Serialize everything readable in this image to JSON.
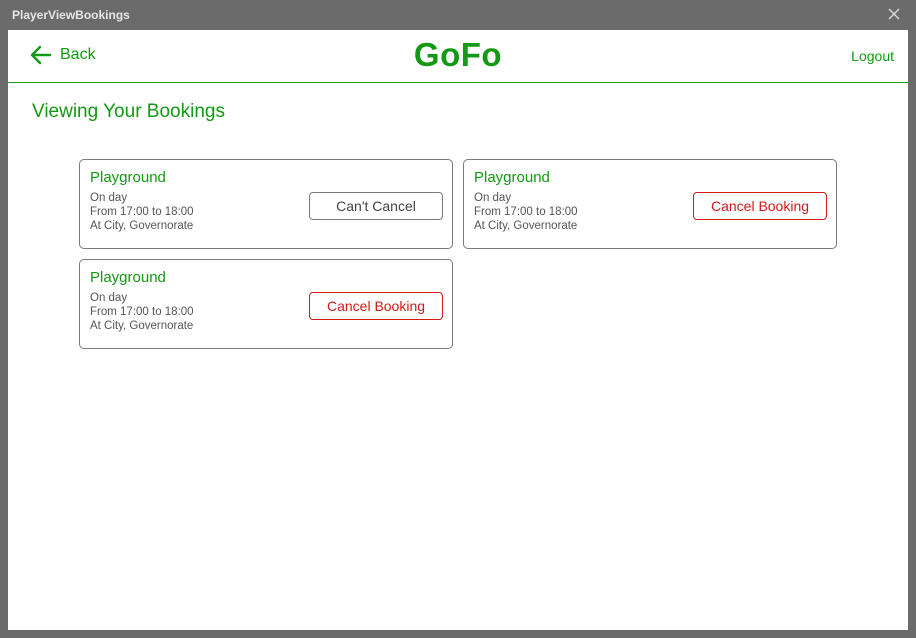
{
  "window": {
    "title": "PlayerViewBookings"
  },
  "header": {
    "back_label": "Back",
    "brand": "GoFo",
    "logout_label": "Logout"
  },
  "page": {
    "title": "Viewing Your Bookings"
  },
  "bookings": [
    {
      "place": "Playground",
      "day": "On day",
      "time": "From 17:00 to 18:00",
      "location": "At City, Governorate",
      "action": "Can't Cancel"
    },
    {
      "place": "Playground",
      "day": "On day",
      "time": "From 17:00 to 18:00",
      "location": "At City, Governorate",
      "action": "Cancel Booking"
    },
    {
      "place": "Playground",
      "day": "On day",
      "time": "From 17:00 to 18:00",
      "location": "At City, Governorate",
      "action": "Cancel Booking"
    }
  ],
  "colors": {
    "accent": "#139913",
    "danger": "#d11a1a",
    "chrome": "#6b6b6b"
  }
}
